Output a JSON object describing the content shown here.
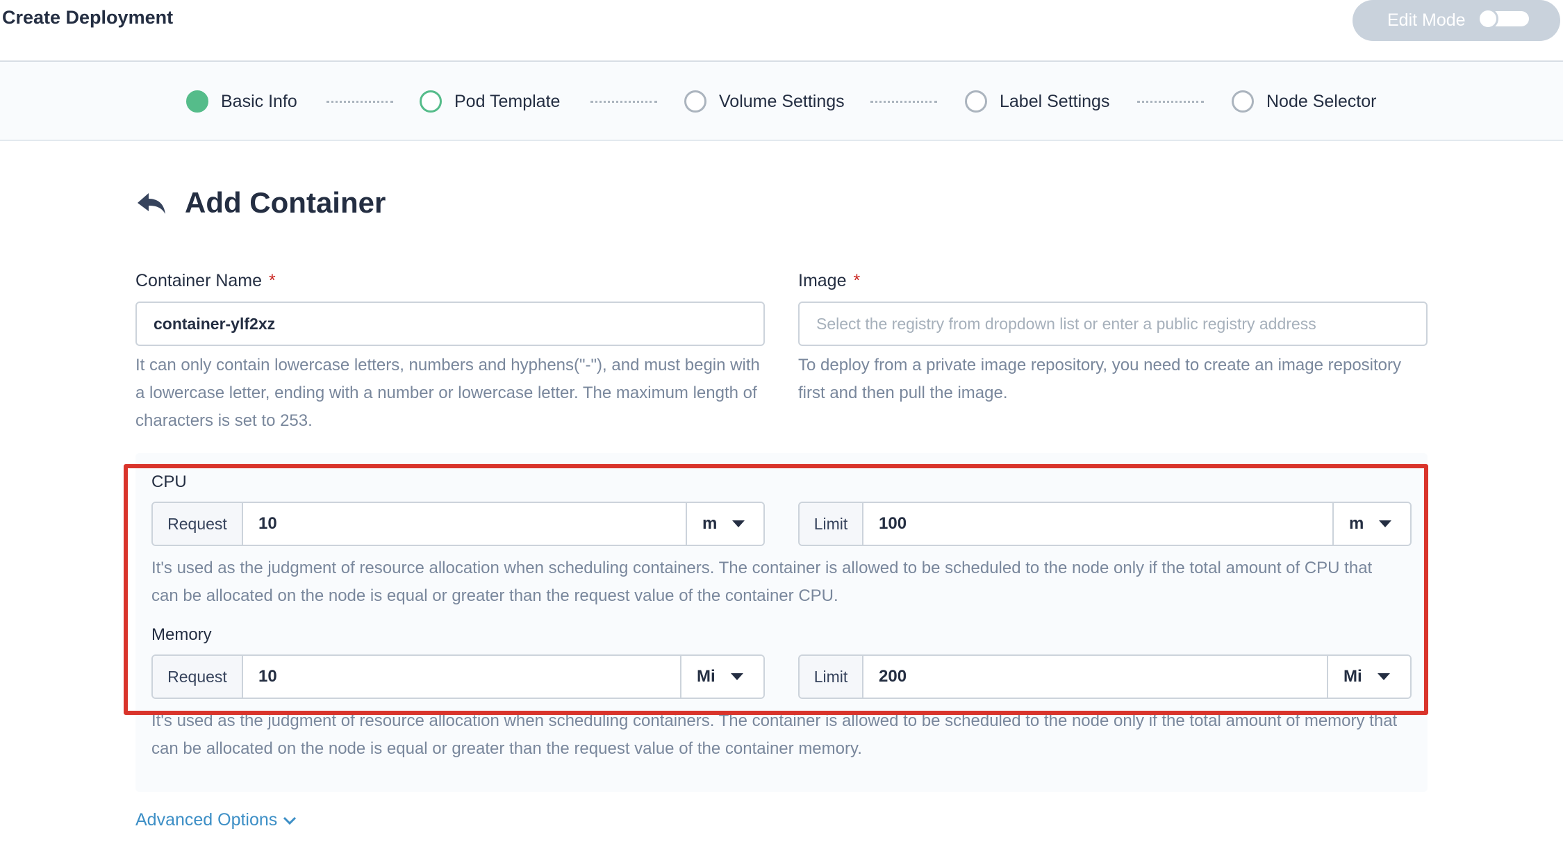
{
  "header": {
    "title": "Create Deployment",
    "edit_mode_label": "Edit Mode"
  },
  "steps": [
    {
      "label": "Basic Info",
      "state": "done"
    },
    {
      "label": "Pod Template",
      "state": "active"
    },
    {
      "label": "Volume Settings",
      "state": "pending"
    },
    {
      "label": "Label Settings",
      "state": "pending"
    },
    {
      "label": "Node Selector",
      "state": "pending"
    }
  ],
  "section": {
    "title": "Add Container",
    "back_icon": "back-arrow-icon"
  },
  "container_name": {
    "label": "Container Name",
    "required_mark": "*",
    "value": "container-ylf2xz",
    "help": "It can only contain lowercase letters, numbers and hyphens(\"-\"), and must begin with a lowercase letter, ending with a number or lowercase letter. The maximum length of characters is set to 253."
  },
  "image": {
    "label": "Image",
    "required_mark": "*",
    "placeholder": "Select the registry from dropdown list or enter a public registry address",
    "help": "To deploy from a private image repository, you need to create an image repository first and then pull the image."
  },
  "cpu": {
    "label": "CPU",
    "request_label": "Request",
    "request_value": "10",
    "request_unit": "m",
    "limit_label": "Limit",
    "limit_value": "100",
    "limit_unit": "m",
    "help": "It's used as the judgment of resource allocation when scheduling containers. The container is allowed to be scheduled to the node only if the total amount of CPU that can be allocated on the node is equal or greater than the request value of the container CPU."
  },
  "memory": {
    "label": "Memory",
    "request_label": "Request",
    "request_value": "10",
    "request_unit": "Mi",
    "limit_label": "Limit",
    "limit_value": "200",
    "limit_unit": "Mi",
    "help": "It's used as the judgment of resource allocation when scheduling containers. The container is allowed to be scheduled to the node only if the total amount of memory that can be allocated on the node is equal or greater than the request value of the container memory."
  },
  "advanced_options": "Advanced Options",
  "colors": {
    "accent_green": "#55bc8a",
    "link_blue": "#3d8fc6",
    "required_red": "#ca2621",
    "highlight_red": "#d9342b"
  }
}
